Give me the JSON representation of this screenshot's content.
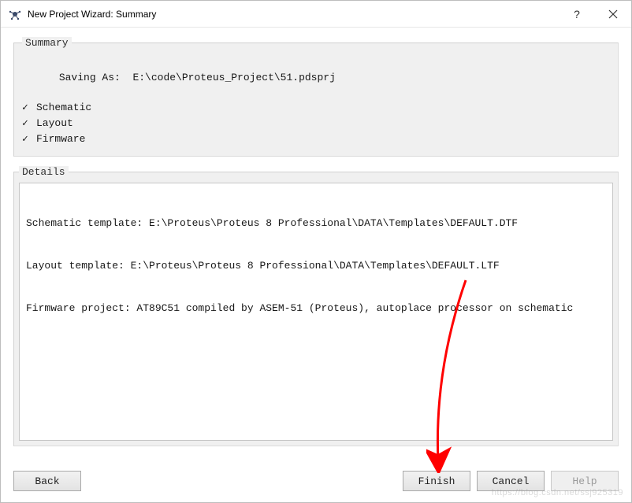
{
  "window": {
    "title": "New Project Wizard: Summary"
  },
  "summary": {
    "legend": "Summary",
    "saving_label": "Saving As:",
    "saving_path": "E:\\code\\Proteus_Project\\51.pdsprj",
    "items": [
      {
        "label": "Schematic"
      },
      {
        "label": "Layout"
      },
      {
        "label": "Firmware"
      }
    ]
  },
  "details": {
    "legend": "Details",
    "lines": [
      "Schematic template: E:\\Proteus\\Proteus 8 Professional\\DATA\\Templates\\DEFAULT.DTF",
      "Layout template: E:\\Proteus\\Proteus 8 Professional\\DATA\\Templates\\DEFAULT.LTF",
      "Firmware project: AT89C51 compiled by ASEM-51 (Proteus), autoplace processor on schematic"
    ]
  },
  "buttons": {
    "back": "Back",
    "finish": "Finish",
    "cancel": "Cancel",
    "help": "Help"
  },
  "watermark": "https://blog.csdn.net/ssj925319"
}
